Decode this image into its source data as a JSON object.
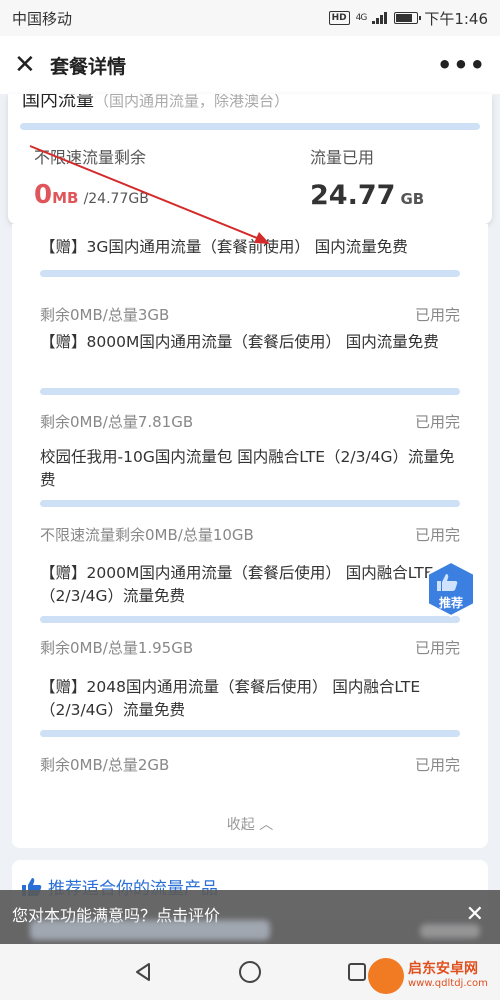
{
  "status_bar": {
    "carrier": "中国移动",
    "hd": "HD",
    "network": "4G",
    "time": "下午1:46"
  },
  "header": {
    "title": "套餐详情"
  },
  "summary": {
    "cut_title": "国内流量",
    "cut_subtitle": "（国内通用流量，除港澳台）",
    "left_label": "不限速流量剩余",
    "left_value": "0",
    "left_unit": "MB",
    "left_total": "/24.77GB",
    "right_label": "流量已用",
    "right_value": "24.77",
    "right_unit": "GB"
  },
  "packages": [
    {
      "name": "【赠】3G国内通用流量（套餐前使用） 国内流量免费",
      "usage": "剩余0MB/总量3GB",
      "status": "已用完",
      "used_fraction": 0
    },
    {
      "name": "【赠】8000M国内通用流量（套餐后使用） 国内流量免费",
      "usage": "剩余0MB/总量7.81GB",
      "status": "已用完",
      "used_fraction": 0
    },
    {
      "name": "校园任我用-10G国内流量包 国内融合LTE（2/3/4G）流量免费",
      "usage": "不限速流量剩余0MB/总量10GB",
      "status": "已用完",
      "used_fraction": 0
    },
    {
      "name": "【赠】2000M国内通用流量（套餐后使用） 国内融合LTE（2/3/4G）流量免费",
      "usage": "剩余0MB/总量1.95GB",
      "status": "已用完",
      "used_fraction": 0
    },
    {
      "name": "【赠】2048国内通用流量（套餐后使用） 国内融合LTE（2/3/4G）流量免费",
      "usage": "剩余0MB/总量2GB",
      "status": "已用完",
      "used_fraction": 0
    }
  ],
  "collapse_label": "收起",
  "recommend": {
    "title": "推荐适合你的流量产品",
    "badge": "推荐"
  },
  "feedback": {
    "question": "您对本功能满意吗？点击评价"
  },
  "watermark": {
    "line1": "启东安卓网",
    "line2": "www.qdltdj.com"
  },
  "colors": {
    "accent": "#2a6fd6",
    "red": "#e0555a",
    "bar": "#cde0f5"
  }
}
